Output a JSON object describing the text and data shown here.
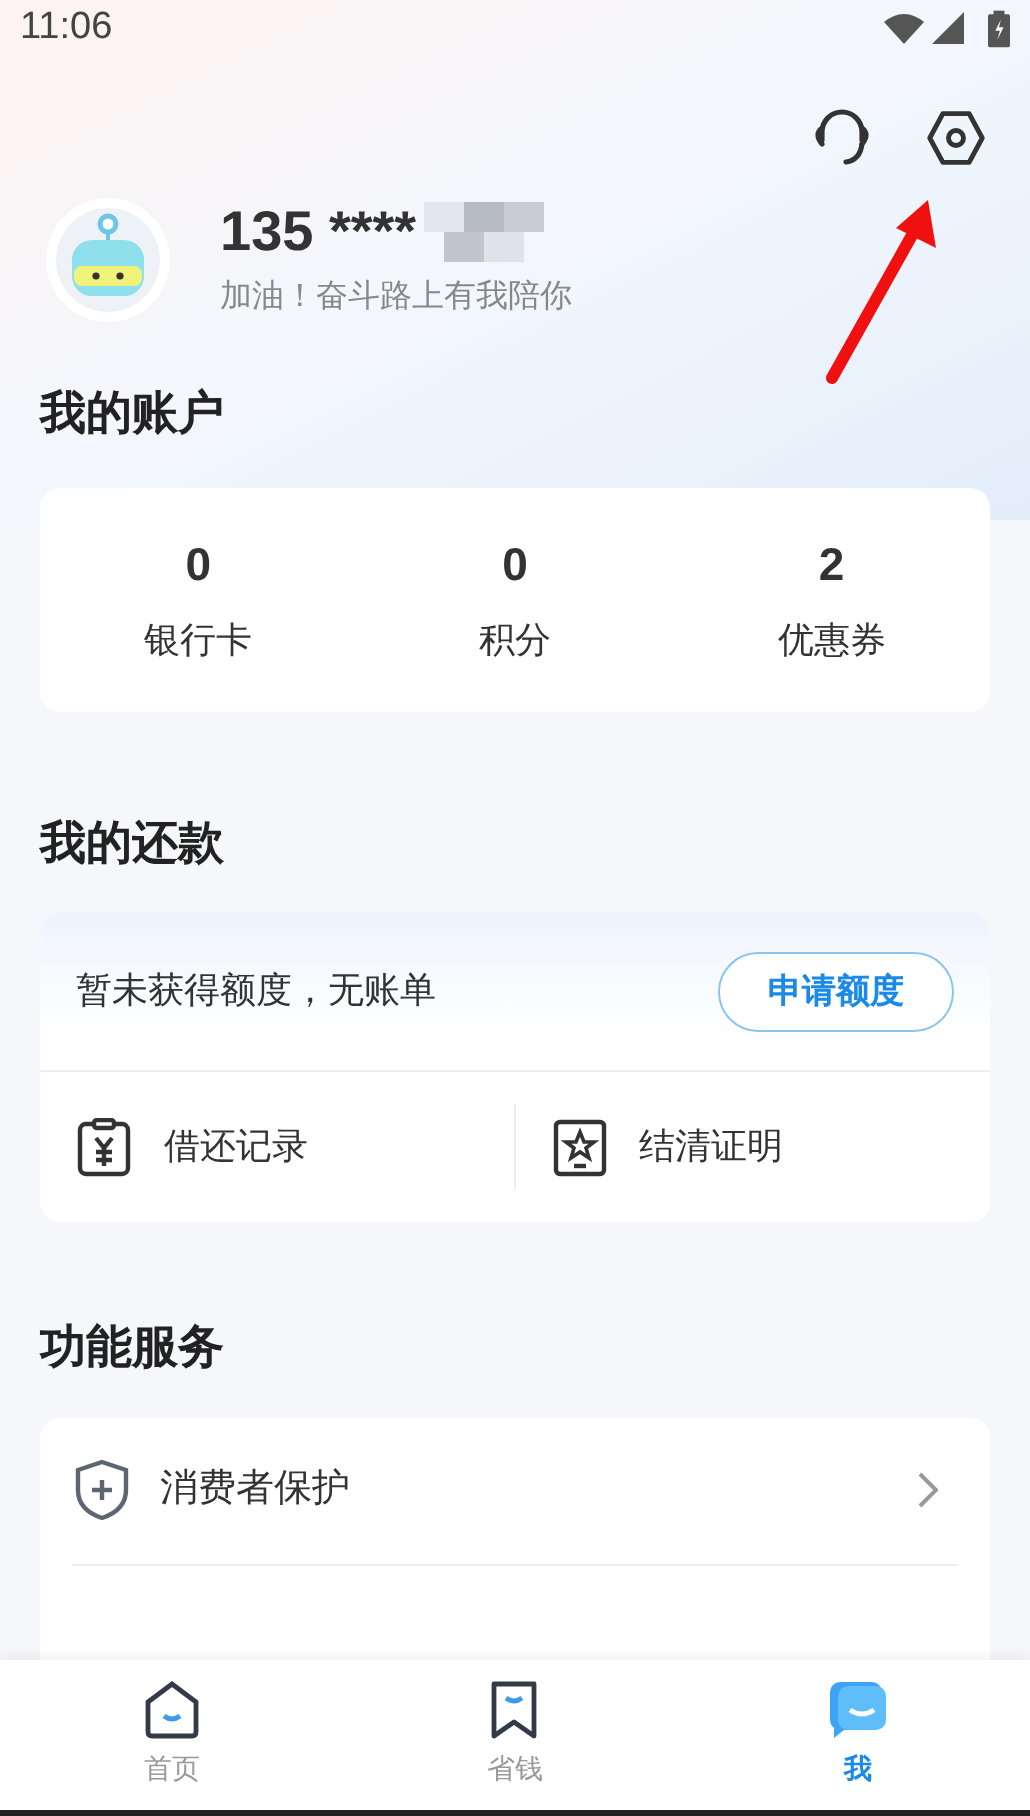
{
  "status_bar": {
    "time": "11:06"
  },
  "profile": {
    "phone": "135 ****",
    "slogan": "加油！奋斗路上有我陪你"
  },
  "account": {
    "title": "我的账户",
    "stats": [
      {
        "value": "0",
        "label": "银行卡"
      },
      {
        "value": "0",
        "label": "积分"
      },
      {
        "value": "2",
        "label": "优惠券"
      }
    ]
  },
  "repayment": {
    "title": "我的还款",
    "status": "暂未获得额度，无账单",
    "apply_button": "申请额度",
    "links": [
      {
        "kind": "record",
        "label": "借还记录"
      },
      {
        "kind": "certificate",
        "label": "结清证明"
      }
    ]
  },
  "services": {
    "title": "功能服务",
    "items": [
      {
        "label": "消费者保护"
      }
    ]
  },
  "bottom_nav": [
    {
      "kind": "home",
      "label": "首页",
      "selected": false
    },
    {
      "kind": "save",
      "label": "省钱",
      "selected": false
    },
    {
      "kind": "me",
      "label": "我",
      "selected": true
    }
  ]
}
